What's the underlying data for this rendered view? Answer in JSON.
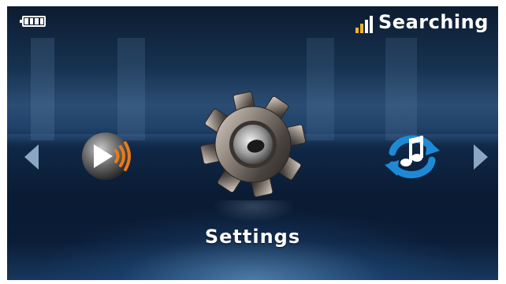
{
  "status_bar": {
    "battery_icon": "battery-full-icon",
    "signal_icon": "signal-bars-icon",
    "status_text": "Searching",
    "signal_colors": [
      "#f0b428",
      "#f0b428",
      "#ffffff",
      "#ffffff"
    ]
  },
  "carousel": {
    "left_arrow_icon": "triangle-left-icon",
    "right_arrow_icon": "triangle-right-icon",
    "items": [
      {
        "icon": "broadcast-play-icon"
      },
      {
        "icon": "gear-icon",
        "selected": true
      },
      {
        "icon": "music-sync-icon"
      }
    ],
    "selected_label": "Settings"
  },
  "colors": {
    "accent_blue": "#1e8ad6",
    "signal_amber": "#f0b428",
    "broadcast_orange": "#e87a1a"
  }
}
